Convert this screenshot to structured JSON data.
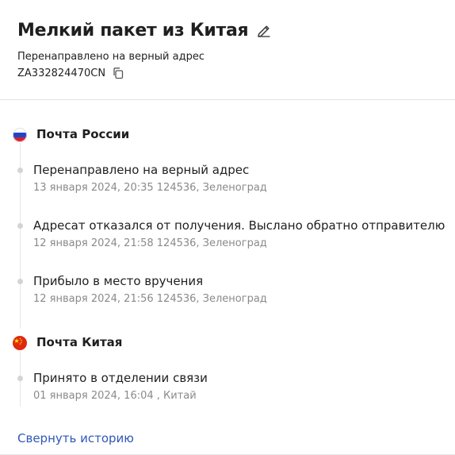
{
  "parcel": {
    "title": "Мелкий пакет из Китая",
    "status": "Перенаправлено на верный адрес",
    "tracking_number": "ZA332824470CN"
  },
  "carriers": [
    {
      "name": "Почта России",
      "flag": "russia-flag",
      "events": [
        {
          "title": "Перенаправлено на верный адрес",
          "meta": "13 января 2024, 20:35 124536, Зеленоград"
        },
        {
          "title": "Адресат отказался от получения. Выслано обратно отправителю",
          "meta": "12 января 2024, 21:58 124536, Зеленоград"
        },
        {
          "title": "Прибыло в место вручения",
          "meta": "12 января 2024, 21:56 124536, Зеленоград"
        }
      ]
    },
    {
      "name": "Почта Китая",
      "flag": "china-flag",
      "events": [
        {
          "title": "Принято в отделении связи",
          "meta": "01 января 2024, 16:04 , Китай"
        }
      ]
    }
  ],
  "actions": {
    "collapse_history": "Свернуть историю"
  },
  "icons": {
    "edit": "pencil-icon",
    "copy": "copy-icon"
  },
  "colors": {
    "link": "#2f57b8",
    "meta_text": "#8a8a8a",
    "dot": "#d4d4d4"
  }
}
